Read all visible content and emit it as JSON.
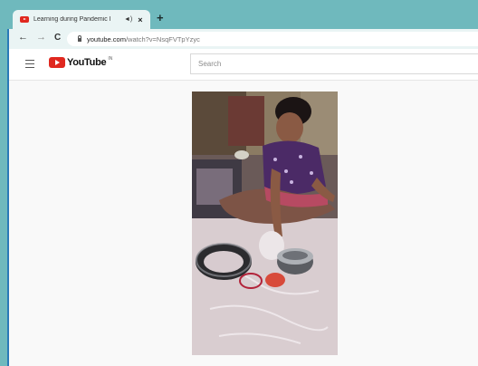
{
  "browser": {
    "tab": {
      "title": "Learning during Pandemic I",
      "audio_icon": "speaker-icon",
      "close_label": "×"
    },
    "new_tab_label": "+",
    "toolbar": {
      "back": "←",
      "forward": "→",
      "reload": "C"
    },
    "address": {
      "host": "youtube.com",
      "path": "/watch?v=NsqFVTpYzyc"
    }
  },
  "youtube": {
    "logo_text": "YouTube",
    "country_code": "IN",
    "search_placeholder": "Search"
  },
  "colors": {
    "tab_strip": "#6fb9bd",
    "toolbar": "#eaf4f4",
    "brand_red": "#e0281f",
    "page_bg": "#f9f9f9"
  }
}
